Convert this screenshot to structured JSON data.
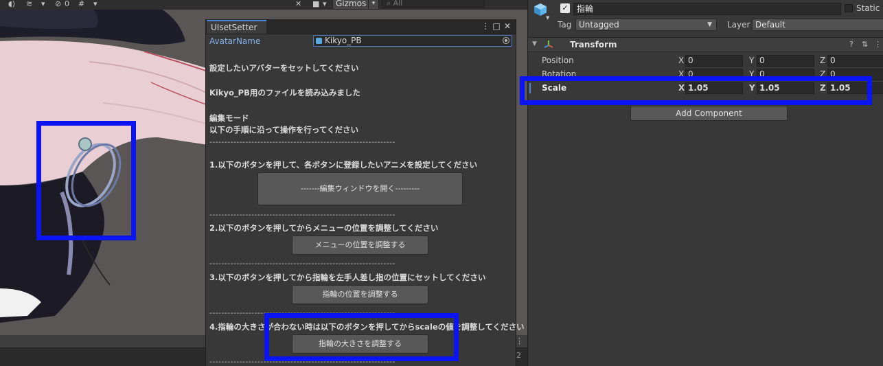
{
  "scene": {
    "gizmos_label": "Gizmos",
    "search_placeholder": "All",
    "hidden_count": "0",
    "side_number": "2"
  },
  "ui_window": {
    "tab_title": "UIsetSetter",
    "avatar_label": "AvatarName",
    "avatar_value": "Kikyo_PB",
    "lines": {
      "set_avatar": "設定したいアバターをセットしてください",
      "loaded": "Kikyo_PB用のファイルを読み込みました",
      "edit_mode": "編集モード",
      "follow_steps": "以下の手順に沿って操作を行ってください",
      "step1": "1.以下のボタンを押して、各ボタンに登録したいアニメを設定してください",
      "step2": "2.以下のボタンを押してからメニューの位置を調整してください",
      "step3": "3.以下のボタンを押してから指輪を左手人差し指の位置にセットしてください",
      "step4": "4.指輪の大きさが合わない時は以下のボタンを押してからscaleの値を調整してください"
    },
    "separator": "--------------------------------------------------------------",
    "buttons": {
      "open_editor": "-------編集ウィンドウを開く---------",
      "adjust_menu": "メニューの位置を調整する",
      "adjust_ring_pos": "指輪の位置を調整する",
      "adjust_ring_size": "指輪の大きさを調整する"
    }
  },
  "inspector": {
    "object_name": "指輪",
    "static_label": "Static",
    "tag_label": "Tag",
    "tag_value": "Untagged",
    "layer_label": "Layer",
    "layer_value": "Default",
    "component_title": "Transform",
    "rows": [
      {
        "label": "Position",
        "x": "0",
        "y": "0",
        "z": "0"
      },
      {
        "label": "Rotation",
        "x": "0",
        "y": "0",
        "z": "0"
      },
      {
        "label": "Scale",
        "x": "1.05",
        "y": "1.05",
        "z": "1.05"
      }
    ],
    "axis": {
      "x": "X",
      "y": "Y",
      "z": "Z"
    },
    "add_component": "Add Component"
  },
  "colors": {
    "highlight": "#0a14f5",
    "scene_background": "#5a5656",
    "panel": "#383838"
  }
}
